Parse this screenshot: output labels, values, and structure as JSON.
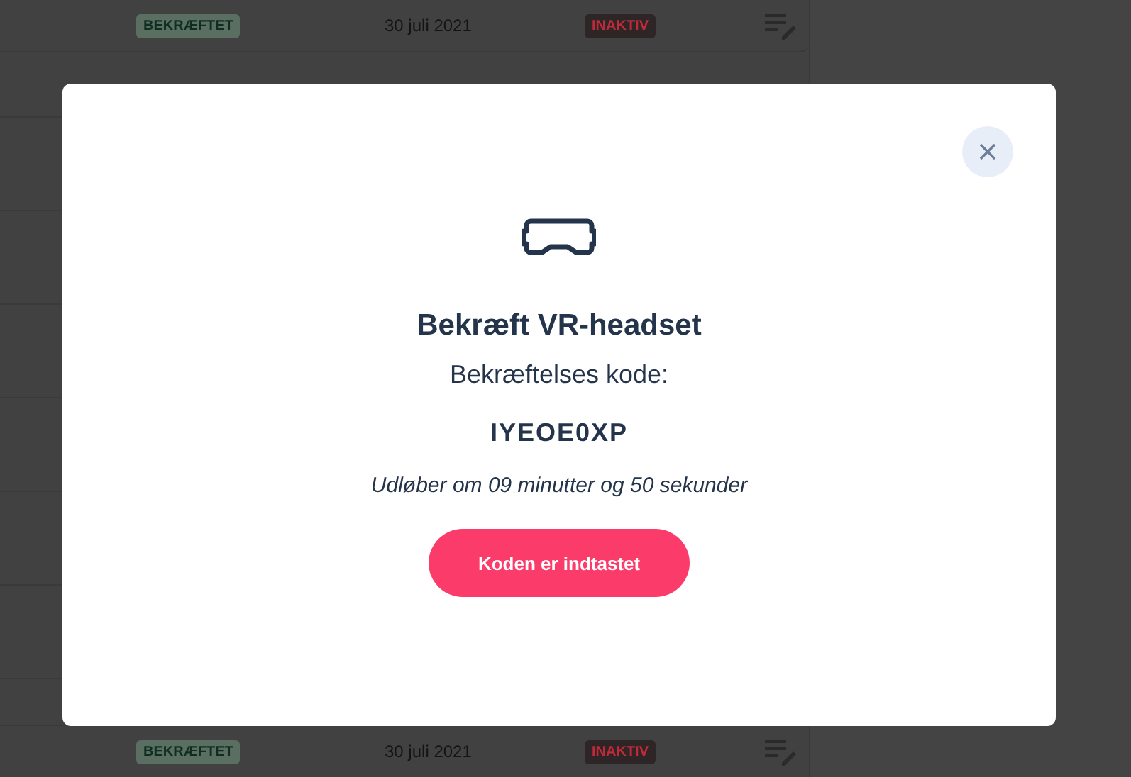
{
  "background_rows": [
    {
      "status": "BEKRÆFTET",
      "date": "30 juli 2021",
      "activity": "INAKTIV"
    },
    {
      "status": "BEKRÆFTET",
      "date": "30 juli 2021",
      "activity": "INAKTIV"
    }
  ],
  "modal": {
    "title": "Bekræft VR-headset",
    "label": "Bekræftelses kode:",
    "code": "IYEOE0XP",
    "expiry": "Udløber om 09 minutter og 50 sekunder",
    "button": "Koden er indtastet"
  }
}
